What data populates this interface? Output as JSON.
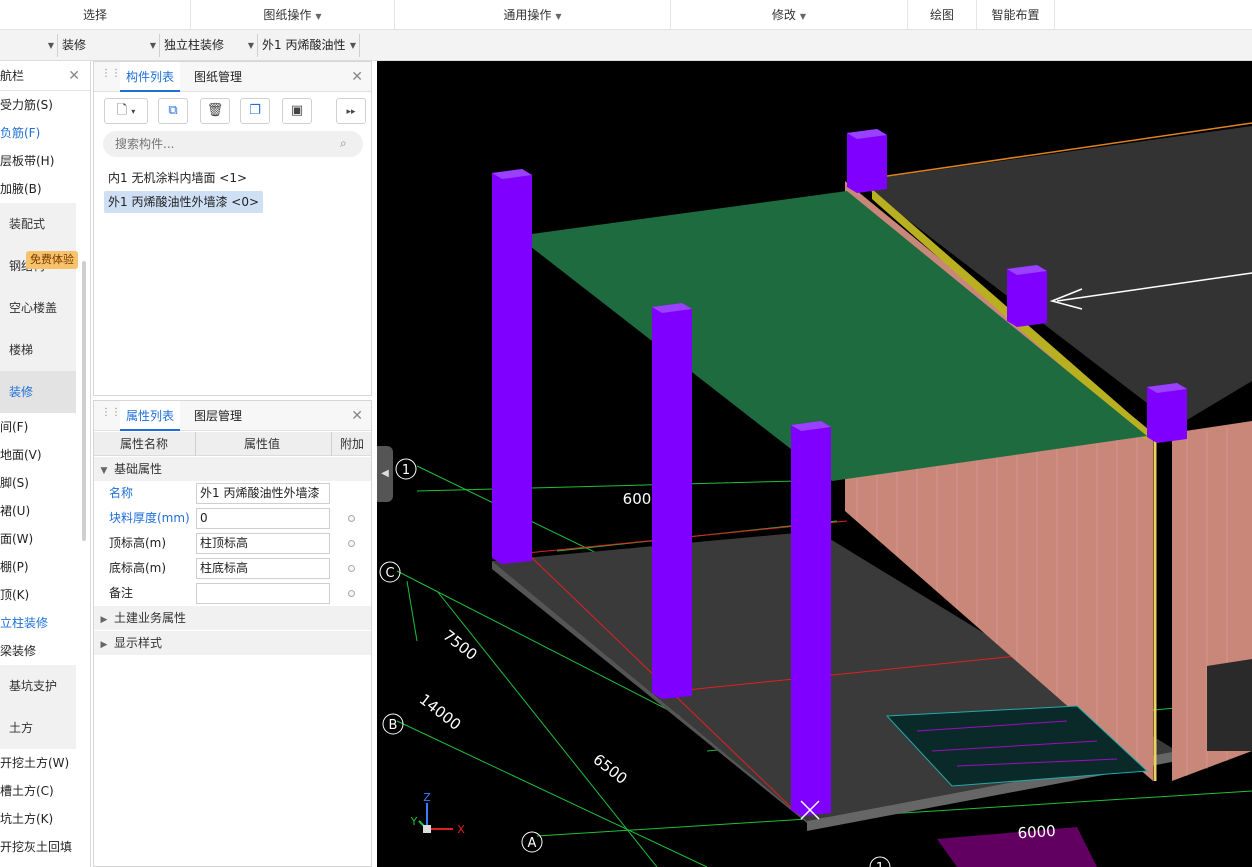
{
  "ribbon": {
    "groups": [
      {
        "label": "选择",
        "dropdown": false
      },
      {
        "label": "图纸操作",
        "dropdown": true
      },
      {
        "label": "通用操作",
        "dropdown": true
      },
      {
        "label": "修改",
        "dropdown": true
      },
      {
        "label": "绘图",
        "dropdown": false
      },
      {
        "label": "智能布置",
        "dropdown": false
      }
    ]
  },
  "selectors": {
    "floor": "",
    "category": "装修",
    "type": "独立柱装修",
    "component": "外1 丙烯酸油性"
  },
  "nav": {
    "title": "航栏",
    "items_top": [
      "受力筋(S)",
      "负筋(F)",
      "层板带(H)",
      "加腋(B)"
    ],
    "categories_a": [
      "装配式",
      "钢结构",
      "空心楼盖",
      "楼梯",
      "装修"
    ],
    "badge": "免费体验",
    "items_mid": [
      "间(F)",
      "地面(V)",
      "脚(S)",
      "裙(U)",
      "面(W)",
      "棚(P)",
      "顶(K)",
      "立柱装修",
      "梁装修"
    ],
    "categories_b": [
      "基坑支护",
      "土方"
    ],
    "items_bottom": [
      "开挖土方(W)",
      "槽土方(C)",
      "坑土方(K)",
      "开挖灰土回填"
    ]
  },
  "component_panel": {
    "tabs": [
      "构件列表",
      "图纸管理"
    ],
    "search_placeholder": "搜索构件...",
    "items": [
      "内1 无机涂料内墙面 <1>",
      "外1 丙烯酸油性外墙漆 <0>"
    ],
    "selected_index": 1,
    "toolbar_icons": [
      "new-icon",
      "copy-icon",
      "delete-icon",
      "duplicate-icon",
      "save-icon",
      "more-icon"
    ]
  },
  "properties_panel": {
    "tabs": [
      "属性列表",
      "图层管理"
    ],
    "columns": [
      "属性名称",
      "属性值",
      "附加"
    ],
    "group_basic": "基础属性",
    "rows": [
      {
        "name": "名称",
        "value": "外1 丙烯酸油性外墙漆",
        "blue": true,
        "dot": false
      },
      {
        "name": "块料厚度(mm)",
        "value": "0",
        "blue": true,
        "dot": true
      },
      {
        "name": "顶标高(m)",
        "value": "柱顶标高",
        "blue": false,
        "dot": true
      },
      {
        "name": "底标高(m)",
        "value": "柱底标高",
        "blue": false,
        "dot": true
      },
      {
        "name": "备注",
        "value": "",
        "blue": false,
        "dot": true
      }
    ],
    "group_civil": "土建业务属性",
    "group_display": "显示样式"
  },
  "viewport": {
    "axis_labels": [
      "1",
      "C",
      "B",
      "A",
      "1"
    ],
    "dimensions": [
      "600",
      "7500",
      "14000",
      "6500",
      "6000"
    ],
    "axes": {
      "x": "X",
      "y": "Y",
      "z": "Z"
    },
    "colors": {
      "background": "#000000",
      "column": "#7f00ff",
      "slab": "#1e6b40",
      "floor": "#3a3a3a",
      "brick": "#c9877a",
      "grid": "#1fbf3a",
      "redline": "#e02020"
    }
  }
}
